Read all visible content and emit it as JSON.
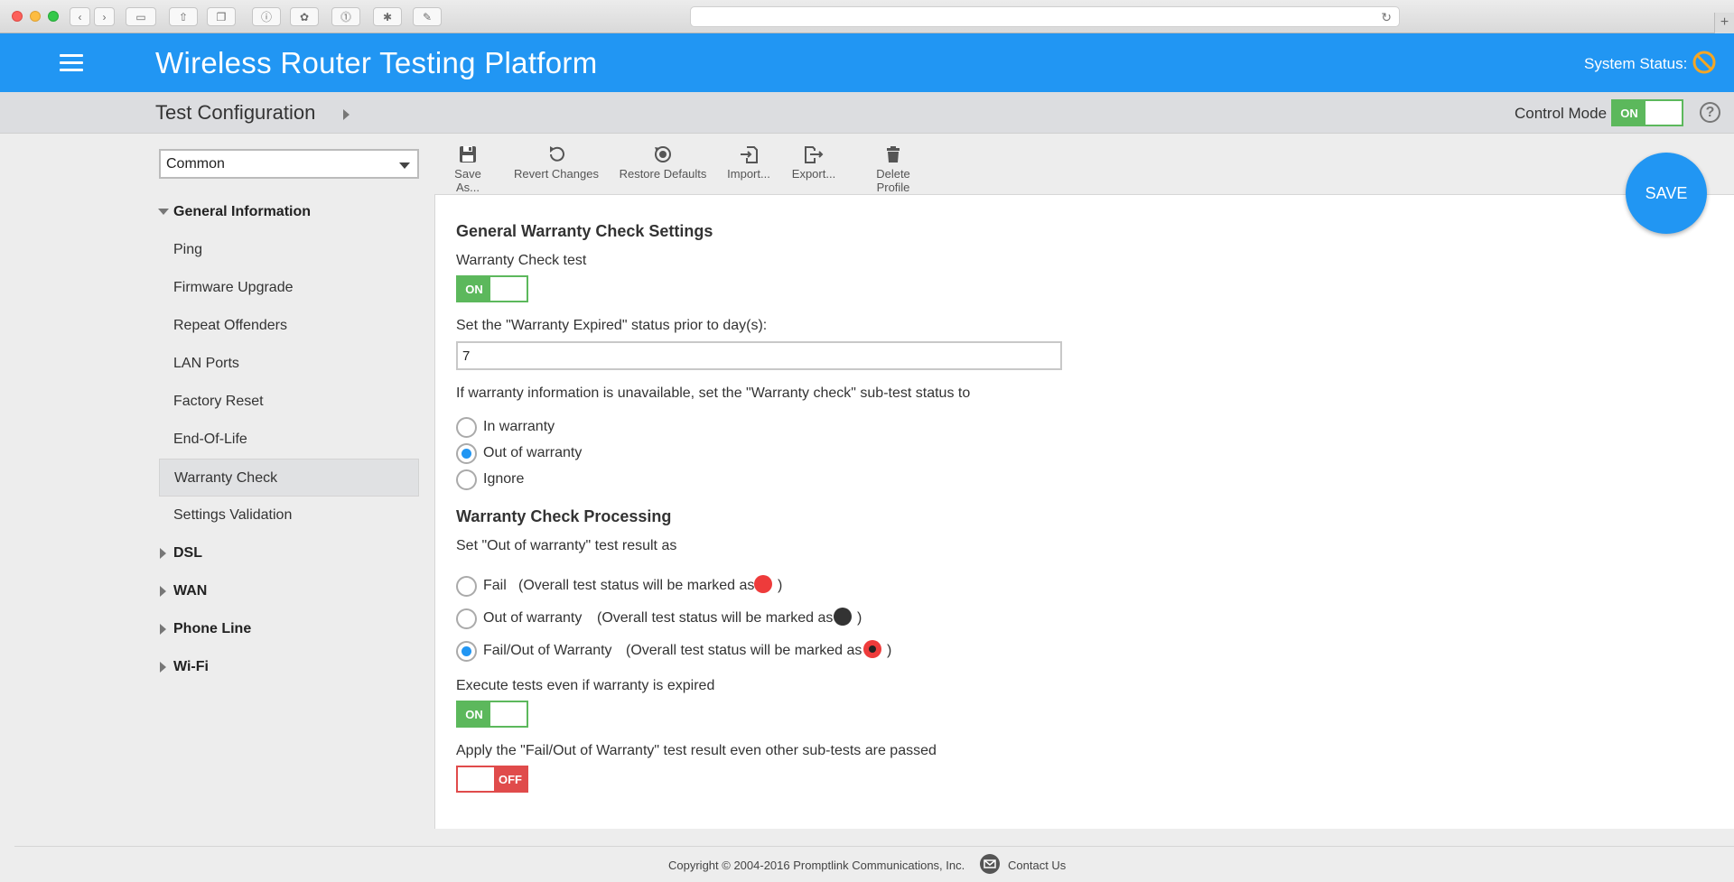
{
  "app": {
    "title": "Wireless Router Testing Platform",
    "system_status_label": "System Status:",
    "brand_color": "#2196f3"
  },
  "subheader": {
    "page_title": "Test Configuration",
    "control_mode_label": "Control Mode",
    "control_mode_state": "ON",
    "help_icon": "?"
  },
  "sidebar": {
    "profile_value": "Common",
    "groups": [
      {
        "label": "General Information",
        "expanded": true
      },
      {
        "label": "DSL",
        "expanded": false
      },
      {
        "label": "WAN",
        "expanded": false
      },
      {
        "label": "Phone Line",
        "expanded": false
      },
      {
        "label": "Wi-Fi",
        "expanded": false
      }
    ],
    "items": [
      {
        "label": "Ping"
      },
      {
        "label": "Firmware Upgrade"
      },
      {
        "label": "Repeat Offenders"
      },
      {
        "label": "LAN Ports"
      },
      {
        "label": "Factory Reset"
      },
      {
        "label": "End-Of-Life"
      },
      {
        "label": "Warranty Check",
        "active": true
      },
      {
        "label": "Settings Validation"
      }
    ]
  },
  "toolbar": {
    "save_as": "Save As...",
    "revert": "Revert Changes",
    "restore": "Restore Defaults",
    "import": "Import...",
    "export": "Export...",
    "delete": "Delete Profile",
    "save": "SAVE"
  },
  "content": {
    "general_title": "General Warranty Check Settings",
    "warranty_test_label": "Warranty Check test",
    "warranty_test_state": "ON",
    "expired_label": "Set the \"Warranty Expired\" status prior to day(s):",
    "expired_days": "7",
    "unavailable_label": "If warranty information is unavailable, set the \"Warranty check\" sub-test status to",
    "unavailable_options": [
      {
        "label": "In warranty",
        "selected": false
      },
      {
        "label": "Out of warranty",
        "selected": true
      },
      {
        "label": "Ignore",
        "selected": false
      }
    ],
    "processing_title": "Warranty Check Processing",
    "result_label": "Set \"Out of warranty\" test result as",
    "result_options": [
      {
        "label": "Fail",
        "note": "(Overall test status will be marked as",
        "selected": false,
        "marker": "red"
      },
      {
        "label": "Out of warranty",
        "note": "(Overall test status will be marked as",
        "selected": false,
        "marker": "black"
      },
      {
        "label": "Fail/Out of Warranty",
        "note": "(Overall test status will be marked as",
        "selected": true,
        "marker": "red-black"
      }
    ],
    "close_paren": ")",
    "execute_label": "Execute tests even if warranty is expired",
    "execute_state": "ON",
    "apply_label": "Apply the \"Fail/Out of Warranty\" test result even other sub-tests are passed",
    "apply_state": "OFF"
  },
  "footer": {
    "copyright": "Copyright © 2004-2016 Promptlink Communications, Inc.",
    "contact": "Contact Us"
  }
}
